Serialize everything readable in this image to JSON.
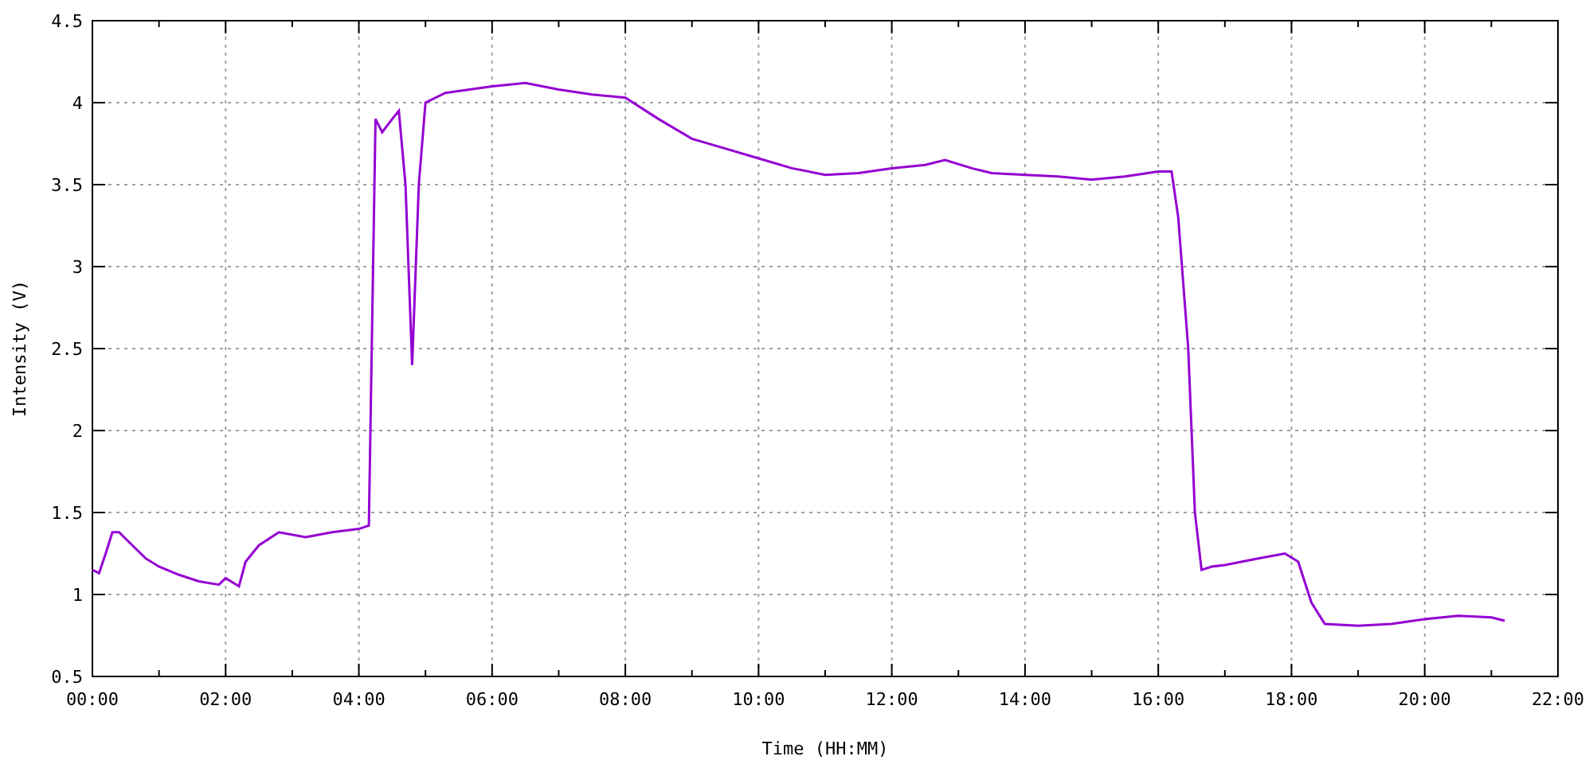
{
  "chart_data": {
    "type": "line",
    "grid": true,
    "xlabel": "Time (HH:MM)",
    "ylabel": "Intensity (V)",
    "xlim": [
      0,
      22
    ],
    "ylim": [
      0.5,
      4.5
    ],
    "xticks": [
      {
        "value": 0,
        "label": "00:00"
      },
      {
        "value": 2,
        "label": "02:00"
      },
      {
        "value": 4,
        "label": "04:00"
      },
      {
        "value": 6,
        "label": "06:00"
      },
      {
        "value": 8,
        "label": "08:00"
      },
      {
        "value": 10,
        "label": "10:00"
      },
      {
        "value": 12,
        "label": "12:00"
      },
      {
        "value": 14,
        "label": "14:00"
      },
      {
        "value": 16,
        "label": "16:00"
      },
      {
        "value": 18,
        "label": "18:00"
      },
      {
        "value": 20,
        "label": "20:00"
      },
      {
        "value": 22,
        "label": "22:00"
      }
    ],
    "yticks": [
      0.5,
      1,
      1.5,
      2,
      2.5,
      3,
      3.5,
      4,
      4.5
    ],
    "x": [
      0,
      0.1,
      0.2,
      0.3,
      0.4,
      0.6,
      0.8,
      1.0,
      1.3,
      1.6,
      1.9,
      2.0,
      2.2,
      2.3,
      2.5,
      2.8,
      3.2,
      3.6,
      4.0,
      4.15,
      4.25,
      4.35,
      4.5,
      4.6,
      4.7,
      4.8,
      4.9,
      5.0,
      5.3,
      6.0,
      6.5,
      7.0,
      7.5,
      8.0,
      8.5,
      9.0,
      9.5,
      10.0,
      10.5,
      11.0,
      11.5,
      12.0,
      12.5,
      12.8,
      13.2,
      13.5,
      14.0,
      14.5,
      15.0,
      15.5,
      16.0,
      16.2,
      16.3,
      16.45,
      16.55,
      16.65,
      16.8,
      17.0,
      17.5,
      17.9,
      18.1,
      18.3,
      18.5,
      19.0,
      19.5,
      20.0,
      20.5,
      21.0,
      21.2
    ],
    "series": [
      {
        "color": "#9400d3",
        "values": [
          1.15,
          1.13,
          1.25,
          1.38,
          1.38,
          1.3,
          1.22,
          1.17,
          1.12,
          1.08,
          1.06,
          1.1,
          1.05,
          1.2,
          1.3,
          1.38,
          1.35,
          1.38,
          1.4,
          1.42,
          3.9,
          3.82,
          3.9,
          3.95,
          3.5,
          2.4,
          3.5,
          4.0,
          4.06,
          4.1,
          4.12,
          4.08,
          4.05,
          4.03,
          3.9,
          3.78,
          3.72,
          3.66,
          3.6,
          3.56,
          3.57,
          3.6,
          3.62,
          3.65,
          3.6,
          3.57,
          3.56,
          3.55,
          3.53,
          3.55,
          3.58,
          3.58,
          3.3,
          2.5,
          1.5,
          1.15,
          1.17,
          1.18,
          1.22,
          1.25,
          1.2,
          0.95,
          0.82,
          0.81,
          0.82,
          0.85,
          0.87,
          0.86,
          0.84
        ]
      }
    ]
  }
}
